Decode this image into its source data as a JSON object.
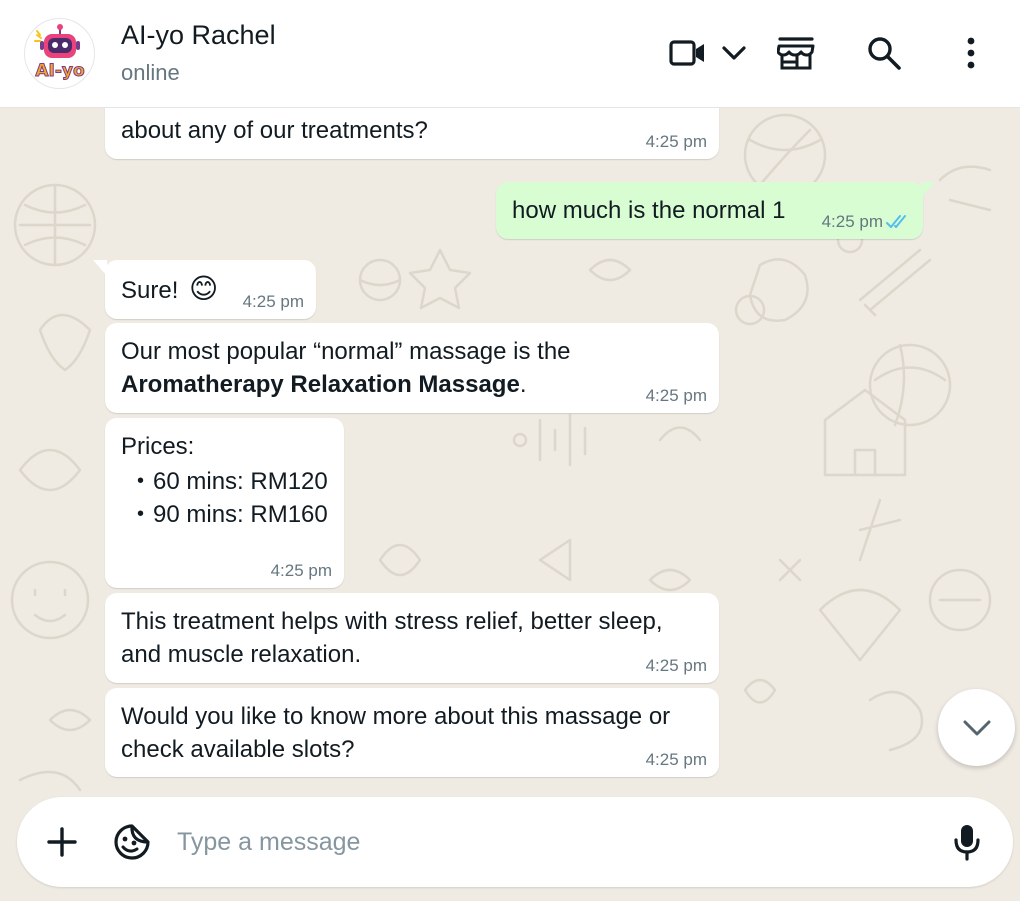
{
  "header": {
    "avatar_text": "AI-yo",
    "contact_name": "AI-yo Rachel",
    "status": "online",
    "icons": [
      "video-call-icon",
      "chevron-down-icon",
      "storefront-icon",
      "search-icon",
      "more-options-icon"
    ]
  },
  "messages": [
    {
      "direction": "in",
      "text": "about any of our treatments?",
      "time": "4:25 pm"
    },
    {
      "direction": "out",
      "text": "how much is the normal 1",
      "time": "4:25 pm",
      "status": "read"
    },
    {
      "direction": "in",
      "text": "Sure!",
      "emoji": "😊",
      "time": "4:25 pm"
    },
    {
      "direction": "in",
      "text_prefix": "Our most popular “normal” massage is the",
      "text_bold": "Aromatherapy Relaxation Massage",
      "text_suffix": ".",
      "time": "4:25 pm"
    },
    {
      "direction": "in",
      "title": "Prices:",
      "items": [
        "60 mins: RM120",
        "90 mins: RM160"
      ],
      "time": "4:25 pm"
    },
    {
      "direction": "in",
      "line1": "This treatment helps with stress relief, better sleep,",
      "line2": "and muscle relaxation.",
      "time": "4:25 pm"
    },
    {
      "direction": "in",
      "line1": "Would you like to know more about this massage or",
      "line2": "check available slots?",
      "time": "4:25 pm"
    }
  ],
  "composer": {
    "placeholder": "Type a message",
    "value": "",
    "icons": [
      "plus-icon",
      "sticker-icon",
      "microphone-icon"
    ]
  },
  "colors": {
    "background": "#efeae2",
    "incoming_bubble": "#ffffff",
    "outgoing_bubble": "#d9fdd3",
    "read_ticks": "#53bdeb",
    "secondary_text": "#667781"
  }
}
